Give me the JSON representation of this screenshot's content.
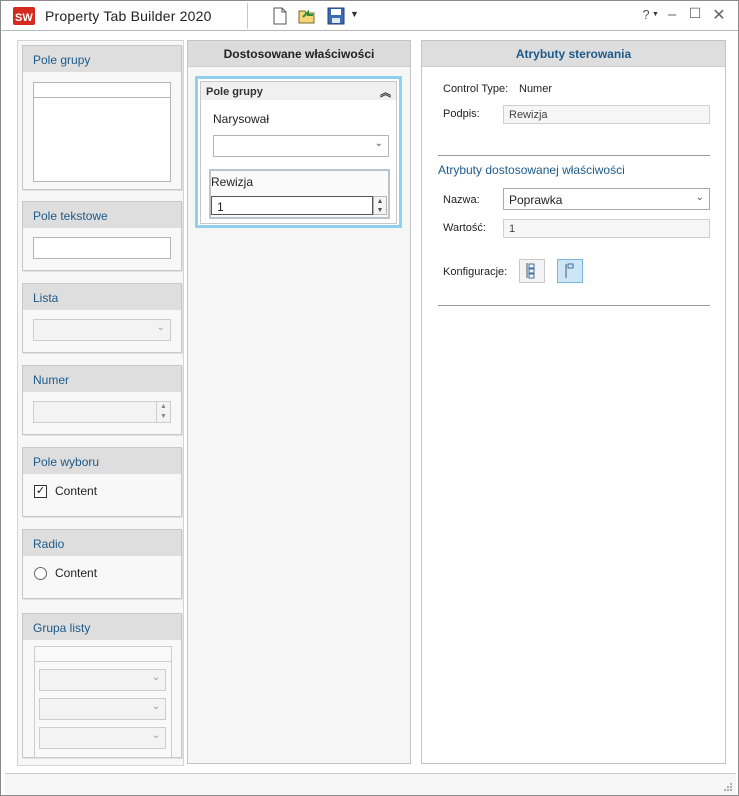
{
  "window": {
    "title": "Property Tab Builder   2020",
    "help_label": "?"
  },
  "palette": {
    "group_box": {
      "title": "Pole grupy"
    },
    "text_box": {
      "title": "Pole tekstowe"
    },
    "list": {
      "title": "Lista"
    },
    "number": {
      "title": "Numer"
    },
    "checkbox": {
      "title": "Pole wyboru",
      "option_label": "Content",
      "checked": true
    },
    "radio": {
      "title": "Radio",
      "option_label": "Content"
    },
    "list_group": {
      "title": "Grupa listy"
    }
  },
  "custom_properties": {
    "header": "Dostosowane właściwości",
    "group": {
      "title": "Pole grupy",
      "drawn_by_label": "Narysował",
      "drawn_by_value": "",
      "revision_label": "Rewizja",
      "revision_value": "1"
    }
  },
  "control_attributes": {
    "header": "Atrybuty sterowania",
    "control_type_label": "Control Type:",
    "control_type_value": "Numer",
    "caption_label": "Podpis:",
    "caption_value": "Rewizja",
    "custom_property_section": "Atrybuty dostosowanej właściwości",
    "name_label": "Nazwa:",
    "name_value": "Poprawka",
    "value_label": "Wartość:",
    "value_value": "1",
    "configurations_label": "Konfiguracje:"
  },
  "colors": {
    "accent_blue": "#1d5a8a",
    "selection_border": "#8fd0ef",
    "app_logo_red": "#d52b1e"
  }
}
